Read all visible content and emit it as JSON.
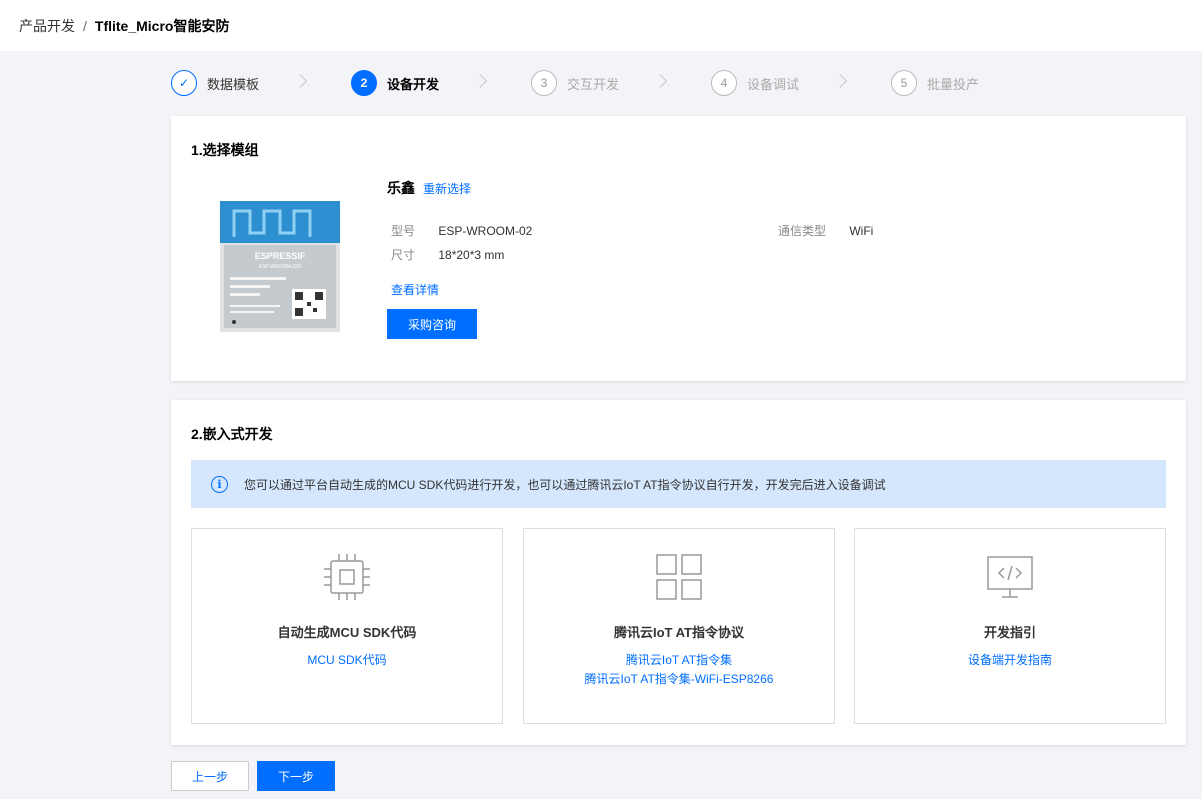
{
  "breadcrumb": {
    "parent": "产品开发",
    "separator": "/",
    "current": "Tflite_Micro智能安防"
  },
  "steps": [
    {
      "num": "✓",
      "label": "数据模板",
      "state": "done"
    },
    {
      "num": "2",
      "label": "设备开发",
      "state": "active"
    },
    {
      "num": "3",
      "label": "交互开发",
      "state": "todo"
    },
    {
      "num": "4",
      "label": "设备调试",
      "state": "todo"
    },
    {
      "num": "5",
      "label": "批量投产",
      "state": "todo"
    }
  ],
  "module_section": {
    "title": "1.选择模组",
    "brand": "乐鑫",
    "reselect": "重新选择",
    "model_key": "型号",
    "model_value": "ESP-WROOM-02",
    "size_key": "尺寸",
    "size_value": "18*20*3 mm",
    "comm_key": "通信类型",
    "comm_value": "WiFi",
    "detail_link": "查看详情",
    "buy_button": "采购咨询",
    "chip_brand": "ESPRESSIF",
    "chip_model": "ESP-WROOM-02D"
  },
  "embedded_section": {
    "title": "2.嵌入式开发",
    "notice_icon": "i",
    "notice": "您可以通过平台自动生成的MCU SDK代码进行开发，也可以通过腾讯云IoT AT指令协议自行开发，开发完后进入设备调试",
    "options": [
      {
        "icon": "chip-icon",
        "title": "自动生成MCU SDK代码",
        "links": [
          "MCU SDK代码"
        ]
      },
      {
        "icon": "grid-icon",
        "title": "腾讯云IoT AT指令协议",
        "links": [
          "腾讯云IoT AT指令集",
          "腾讯云IoT AT指令集-WiFi-ESP8266"
        ]
      },
      {
        "icon": "monitor-code-icon",
        "title": "开发指引",
        "links": [
          "设备端开发指南"
        ]
      }
    ]
  },
  "footer": {
    "prev": "上一步",
    "next": "下一步"
  },
  "colors": {
    "accent": "#006eff",
    "notice_bg": "#d5e7fd",
    "page_bg": "#f3f4f7"
  }
}
